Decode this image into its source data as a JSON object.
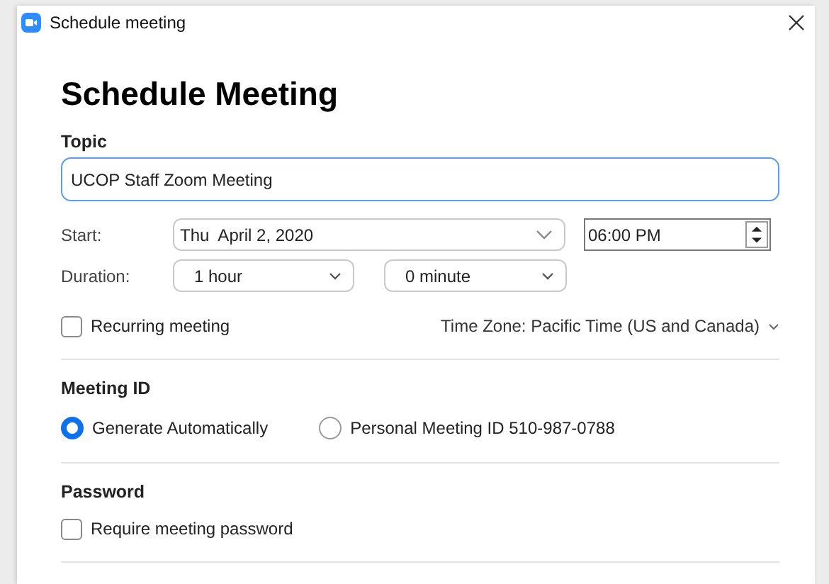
{
  "window": {
    "title": "Schedule meeting"
  },
  "heading": "Schedule Meeting",
  "topic": {
    "label": "Topic",
    "value": "UCOP Staff Zoom Meeting"
  },
  "start": {
    "label": "Start:",
    "date": "Thu  April 2, 2020",
    "time": "06:00 PM"
  },
  "duration": {
    "label": "Duration:",
    "hours": "1 hour",
    "minutes": "0 minute"
  },
  "recurring": {
    "label": "Recurring meeting",
    "checked": false
  },
  "time_zone": "Time Zone: Pacific Time (US and Canada)",
  "meeting_id": {
    "label": "Meeting ID",
    "options": [
      {
        "label": "Generate Automatically",
        "selected": true
      },
      {
        "label": "Personal Meeting ID 510-987-0788",
        "selected": false
      }
    ]
  },
  "password": {
    "label": "Password",
    "require": {
      "label": "Require meeting password",
      "checked": false
    }
  }
}
